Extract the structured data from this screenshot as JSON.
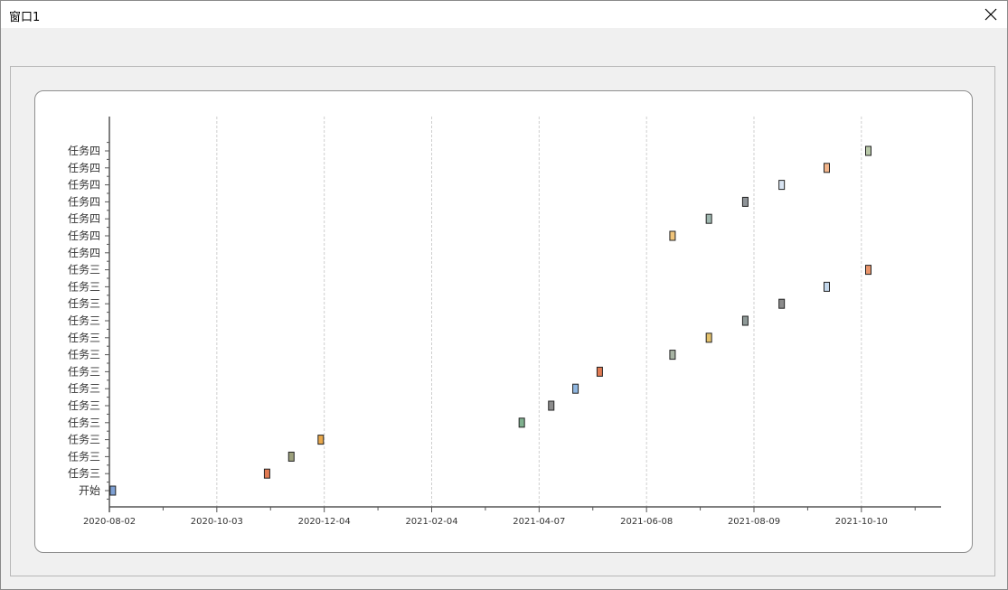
{
  "window": {
    "title": "窗口1"
  },
  "icons": {
    "close": "close-icon"
  },
  "chart_data": {
    "type": "scatter",
    "title": "",
    "xlabel": "",
    "ylabel": "",
    "x_ticks": [
      "2020-08-02",
      "2020-10-03",
      "2020-12-04",
      "2021-02-04",
      "2021-04-07",
      "2021-06-08",
      "2021-08-09",
      "2021-10-10"
    ],
    "xlim": [
      "2020-08-02",
      "2021-11-25"
    ],
    "y_categories": [
      "开始",
      "任务三",
      "任务三",
      "任务三",
      "任务三",
      "任务三",
      "任务三",
      "任务三",
      "任务三",
      "任务三",
      "任务三",
      "任务三",
      "任务三",
      "任务三",
      "任务四",
      "任务四",
      "任务四",
      "任务四",
      "任务四",
      "任务四",
      "任务四"
    ],
    "grid": "vertical dashed",
    "points": [
      {
        "row": 0,
        "x": "2020-08-04",
        "color": "#7ea0d4"
      },
      {
        "row": 1,
        "x": "2020-11-01",
        "color": "#e07a52"
      },
      {
        "row": 2,
        "x": "2020-11-15",
        "color": "#9ca07c"
      },
      {
        "row": 3,
        "x": "2020-12-02",
        "color": "#e9a84b"
      },
      {
        "row": 4,
        "x": "2021-03-28",
        "color": "#7fb08e"
      },
      {
        "row": 5,
        "x": "2021-04-14",
        "color": "#8c8c8c"
      },
      {
        "row": 6,
        "x": "2021-04-28",
        "color": "#8fb6e0"
      },
      {
        "row": 7,
        "x": "2021-05-12",
        "color": "#e07a52"
      },
      {
        "row": 8,
        "x": "2021-06-23",
        "color": "#a8b4a4"
      },
      {
        "row": 9,
        "x": "2021-07-14",
        "color": "#e4c26c"
      },
      {
        "row": 10,
        "x": "2021-08-04",
        "color": "#8f9a98"
      },
      {
        "row": 11,
        "x": "2021-08-25",
        "color": "#8c8c8c"
      },
      {
        "row": 12,
        "x": "2021-09-20",
        "color": "#c4d8ec"
      },
      {
        "row": 13,
        "x": "2021-10-14",
        "color": "#e9956b"
      },
      {
        "row": 15,
        "x": "2021-06-23",
        "color": "#f0c47a"
      },
      {
        "row": 16,
        "x": "2021-07-14",
        "color": "#9fb8b0"
      },
      {
        "row": 17,
        "x": "2021-08-04",
        "color": "#8f9498"
      },
      {
        "row": 18,
        "x": "2021-08-25",
        "color": "#d8e4f2"
      },
      {
        "row": 19,
        "x": "2021-09-20",
        "color": "#f2b48a"
      },
      {
        "row": 20,
        "x": "2021-10-14",
        "color": "#b8c8a8"
      }
    ]
  }
}
